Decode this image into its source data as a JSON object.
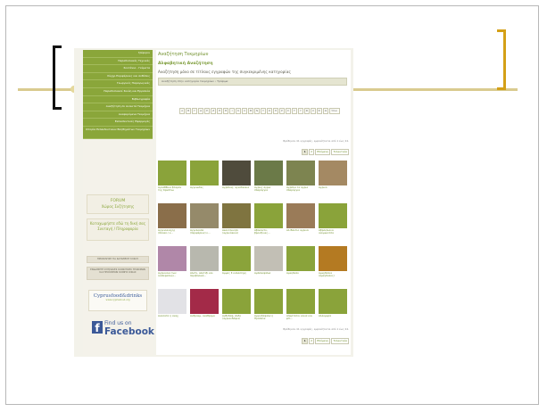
{
  "sidebar": {
    "menu": [
      "Γρίφοροι",
      "Παραδοσιακές Τεχνικές",
      "Σκοτάνια - Γεύματα",
      "Σύγχρ.Περιφέρειες και Ανθίσεις",
      "Γεωργικές Παραγωγικές",
      "Παραδοσιακοί Σκεύη και Εργαλεία",
      "Βιβλιογραφία",
      "Αναζήτηση σε Ανοικτά Τεκμήρια",
      "Αναφερόμενα Τεκμήρια",
      "Εκπαιδευτικές Εφαρμογές",
      "Ιστορία Εκπαιδευτικών Βοηθημάτων Τεκμηρίων"
    ],
    "forum_title": "FORUM",
    "forum_sub": "Χώρος Συζήτησης",
    "submit_text": "Καταχωρήστε εδώ τη δική σας Συνταγή / Πληροφορία",
    "program_text": "ΠΡΟΣΚΛΗΣΗ ΓΙΑ ΚΑΤΑΘΕΣΗ ΥΛΙΚΟΥ",
    "assoc_text": "ΕΝΔΑΙΜΕΤΕ ΚΥΠΡΙΑΚΕΣ ΚΟΙΝΟΤΙΚΕΣ ΤΡΟΦΙΜΩΝ ΚΑΙ ΠΡΟΪΟΝΤΩΝ ΚΟΙΝΗΣ ΟΙΚΙΑΣ",
    "logo_text": "Cyprusfood&drinks",
    "logo_sub": "www.cyprusfood.org",
    "fb_find": "Find us on",
    "fb_name": "Facebook",
    "fb_letter": "f"
  },
  "main": {
    "title": "Αναζήτηση Τεκμηρίων",
    "subtitle": "Αλφαβητική Αναζήτηση",
    "description": "Αναζήτηση μόνο σε τίτλους εγγραφών της συγκεκριμένης κατηγορίας",
    "breadcrumb": "Αναζήτηση στην κατηγορία τεκμηρίων ›  Τρόφιμα",
    "letters": [
      "Α",
      "Β",
      "Γ",
      "Δ",
      "Ε",
      "Ζ",
      "Η",
      "Θ",
      "Ι",
      "Κ",
      "Λ",
      "Μ",
      "Ν",
      "Ξ",
      "Ο",
      "Π",
      "Ρ",
      "Σ",
      "Τ",
      "Υ",
      "Φ",
      "Χ",
      "Ψ",
      "Ω",
      "Όλα"
    ],
    "results_text": "Βρέθηκαν 41 εγγραφές, εμφανίζονται από 1 έως 24.",
    "pager": [
      "1",
      "2",
      "Επόμενη",
      "Τελευταία"
    ],
    "items": [
      "Αγκάθθεια Σπαράν της Κρυπτιώ",
      "Αγγειώδες",
      "Αγρίδιας, αγνόδελεια",
      "Αγρίες άγρια σπαράγγια",
      "Αγρίδια τα άγρια σπαράγγια",
      "Αγρινό",
      "Αγγειοανεχής (Ολοκλ.) ε...",
      "Αγγελούσα (περιφέρεια) ε...",
      "Ακαντόκνηπι (αγρινάκκια)",
      "Αβοκάντο, βρουζίνιες...",
      "Αλ Βάκτιο αγρινά",
      "Αβρόκλιανα ανεμώνιτσα",
      "Αγριονοια των (καπερασιώ)...",
      "Αλάτι, αλατίζι και περιβολικά...",
      "Άμμος Σ καλλιπηγη",
      "Αμπελοφάλια",
      "Αμύγδαλο",
      "Αμυγδάλια (Αμύγδαλος)",
      "Αναλατα ή αναχ",
      "Ανδρούμ, αναθρέμα",
      "Ανθοδάφ, Άλδο (άγριανδάφια)",
      "Αμνοιζάφαλα ή Πράσανκ",
      "Απαρτάτοι ελινά και φτί...",
      "Αλλομυρά"
    ],
    "photo_colors": [
      "#8aa33a",
      "#8aa33a",
      "#4f4b3c",
      "#6b7a48",
      "#7d8450",
      "#a48963",
      "#8a6e4a",
      "#958a6a",
      "#7f7440",
      "#8aa33a",
      "#9a7b58",
      "#8aa33a",
      "#b087a8",
      "#b8b8ae",
      "#8aa33a",
      "#c2bfb5",
      "#8aa33a",
      "#b47a22",
      "#e2e2e6",
      "#a32a48",
      "#8aa33a",
      "#8aa33a",
      "#8aa33a",
      "#8aa33a"
    ]
  }
}
